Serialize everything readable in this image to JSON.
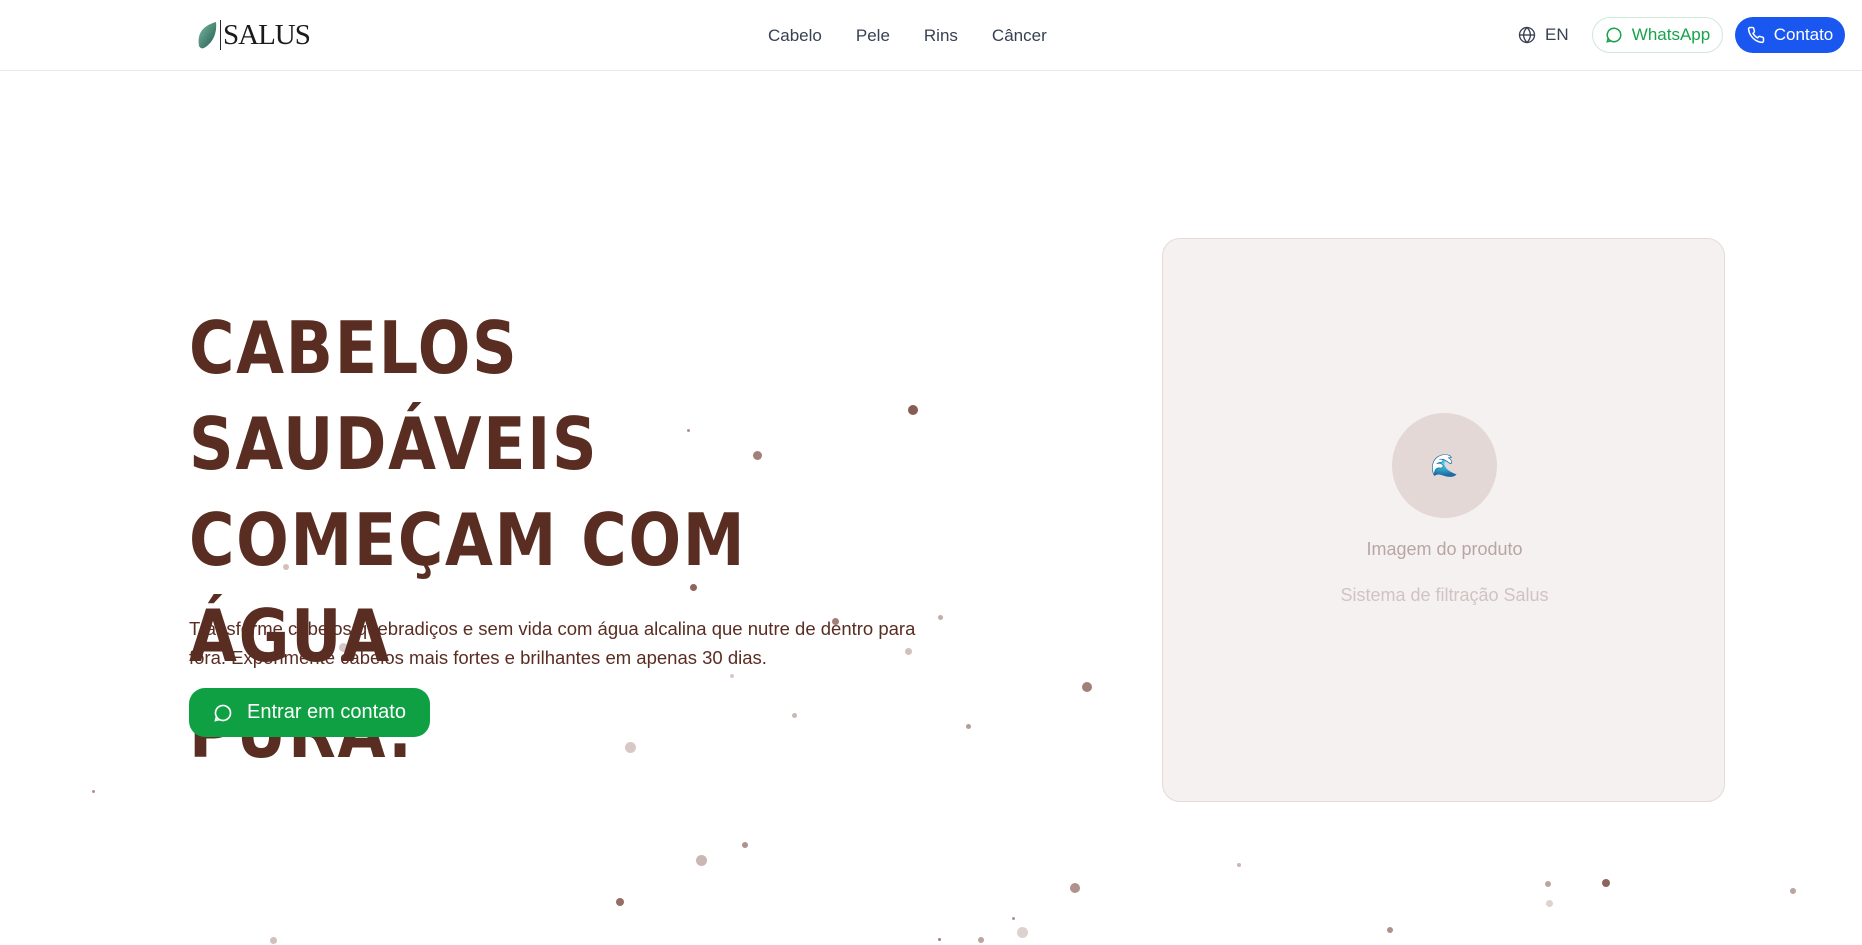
{
  "header": {
    "brand": "SALUS",
    "nav": [
      {
        "label": "Cabelo"
      },
      {
        "label": "Pele"
      },
      {
        "label": "Rins"
      },
      {
        "label": "Câncer"
      }
    ],
    "language": "EN",
    "whatsapp_label": "WhatsApp",
    "contact_label": "Contato"
  },
  "hero": {
    "title_lines": [
      "CABELOS SAUDÁVEIS",
      "COMEÇAM COM ÁGUA",
      "PURA."
    ],
    "description": "Transforme cabelos quebradiços e sem vida com água alcalina que nutre de dentro para fora. Experimente cabelos mais fortes e brilhantes em apenas 30 dias.",
    "cta_label": "Entrar em contato"
  },
  "product": {
    "icon": "water-wave-icon",
    "title": "Imagem do produto",
    "subtitle": "Sistema de filtração Salus"
  },
  "colors": {
    "heading": "#5a2d22",
    "whatsapp_green": "#0ea043",
    "contact_blue": "#1a56f0",
    "card_bg": "#f5f1f0",
    "particle": "#7a4a40"
  }
}
